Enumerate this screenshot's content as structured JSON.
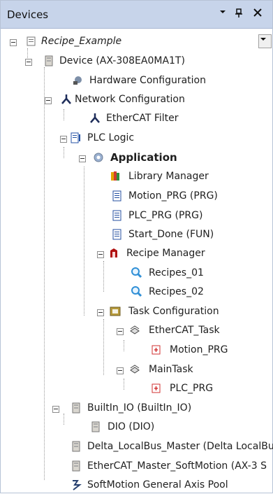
{
  "panel": {
    "title": "Devices",
    "buttons": {
      "menu": "▾",
      "pin": "pin",
      "close": "close"
    }
  },
  "tree": [
    {
      "label": "Recipe_Example",
      "icon": "project-icon",
      "expanded": true
    },
    {
      "label": "Device (AX-308EA0MA1T)",
      "icon": "device-icon",
      "expanded": true
    },
    {
      "label": "Hardware Configuration",
      "icon": "hardware-configuration-icon"
    },
    {
      "label": "Network Configuration",
      "icon": "network-configuration-icon",
      "expanded": true
    },
    {
      "label": "EtherCAT Filter",
      "icon": "ethercat-filter-icon"
    },
    {
      "label": "PLC Logic",
      "icon": "plc-logic-icon",
      "expanded": true
    },
    {
      "label": "Application",
      "icon": "application-icon",
      "expanded": true
    },
    {
      "label": "Library Manager",
      "icon": "library-manager-icon"
    },
    {
      "label": "Motion_PRG (PRG)",
      "icon": "program-icon"
    },
    {
      "label": "PLC_PRG (PRG)",
      "icon": "program-icon"
    },
    {
      "label": "Start_Done (FUN)",
      "icon": "function-icon"
    },
    {
      "label": "Recipe Manager",
      "icon": "recipe-manager-icon",
      "expanded": true
    },
    {
      "label": "Recipes_01",
      "icon": "recipe-search-icon"
    },
    {
      "label": "Recipes_02",
      "icon": "recipe-search-icon"
    },
    {
      "label": "Task Configuration",
      "icon": "task-configuration-icon",
      "expanded": true
    },
    {
      "label": "EtherCAT_Task",
      "icon": "task-icon",
      "expanded": true
    },
    {
      "label": "Motion_PRG",
      "icon": "program-call-icon"
    },
    {
      "label": "MainTask",
      "icon": "task-icon",
      "expanded": true
    },
    {
      "label": "PLC_PRG",
      "icon": "program-call-icon"
    },
    {
      "label": "BuiltIn_IO (BuiltIn_IO)",
      "icon": "builtin-io-icon",
      "expanded": true
    },
    {
      "label": "DIO (DIO)",
      "icon": "dio-icon"
    },
    {
      "label": "Delta_LocalBus_Master (Delta LocalBus",
      "icon": "localbus-master-icon"
    },
    {
      "label": "EtherCAT_Master_SoftMotion (AX-3 S",
      "icon": "ethercat-master-icon"
    },
    {
      "label": "SoftMotion General Axis Pool",
      "icon": "axis-pool-icon"
    }
  ]
}
